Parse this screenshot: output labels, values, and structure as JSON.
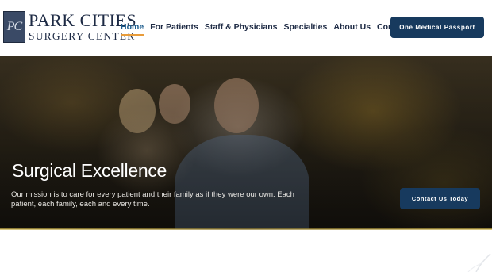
{
  "logo": {
    "mark": "PC",
    "line1": "PARK CITIES",
    "line2": "SURGERY CENTER"
  },
  "nav": {
    "items": [
      {
        "label": "Home",
        "active": true
      },
      {
        "label": "For Patients",
        "active": false
      },
      {
        "label": "Staff & Physicians",
        "active": false
      },
      {
        "label": "Specialties",
        "active": false
      },
      {
        "label": "About Us",
        "active": false
      },
      {
        "label": "Contact",
        "active": false
      }
    ],
    "accent_color": "#e89c3b"
  },
  "header": {
    "passport_button": "One Medical Passport"
  },
  "hero": {
    "title": "Surgical Excellence",
    "text": "Our mission is to care for every patient and their family as if they were our own. Each patient, each family, each and every time.",
    "cta": "Contact Us Today"
  },
  "colors": {
    "brand": "#173a5e",
    "text": "#1d2a44"
  }
}
